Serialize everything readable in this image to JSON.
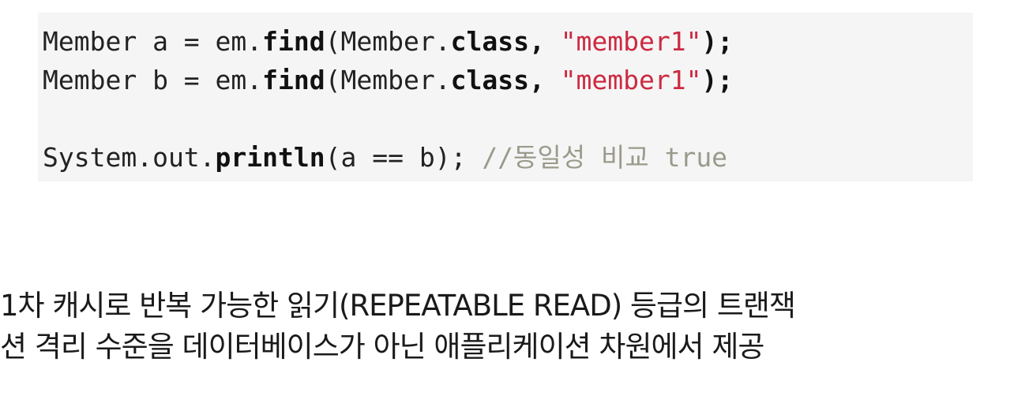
{
  "code": {
    "line1": {
      "prefix": "Member a = em.",
      "method": "find",
      "mid": "(Member.",
      "keyword": "class",
      "comma": ", ",
      "string": "\"member1\"",
      "suffix": ");"
    },
    "line2": {
      "prefix": "Member b = em.",
      "method": "find",
      "mid": "(Member.",
      "keyword": "class",
      "comma": ", ",
      "string": "\"member1\"",
      "suffix": ");"
    },
    "line3": {
      "prefix": "System.out.",
      "method": "println",
      "args": "(a == b); ",
      "comment": "//동일성 비교 true"
    }
  },
  "caption": {
    "line1": "1차 캐시로 반복 가능한 읽기(REPEATABLE READ) 등급의 트랜잭",
    "line2": "션 격리 수준을 데이터베이스가 아닌 애플리케이션 차원에서 제공"
  },
  "colors": {
    "code_background": "#f5f5f5",
    "string": "#cc2a41",
    "comment": "#9a9a8c"
  }
}
